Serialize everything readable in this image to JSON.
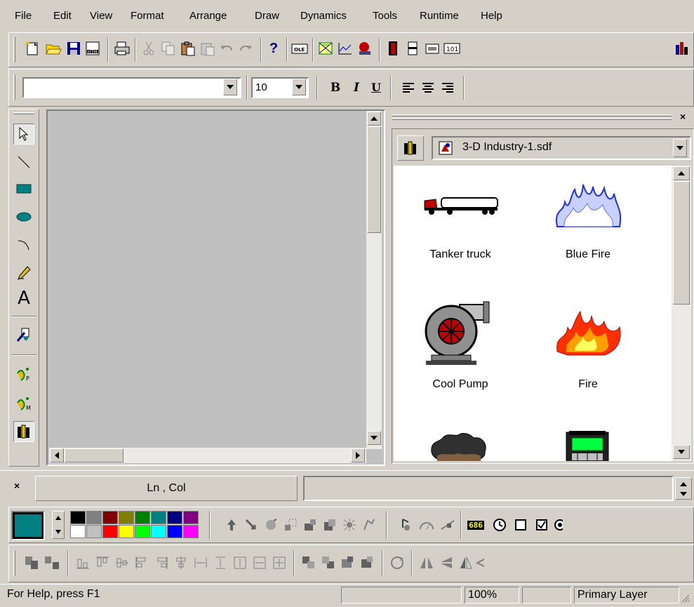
{
  "menu": [
    "File",
    "Edit",
    "View",
    "Format",
    "Arrange",
    "Draw",
    "Dynamics",
    "Tools",
    "Runtime",
    "Help"
  ],
  "format_toolbar": {
    "font_name": "",
    "font_size": "10",
    "bold_label": "B",
    "italic_label": "I",
    "underline_label": "U"
  },
  "library": {
    "file_name": "3-D Industry-1.sdf",
    "items": [
      {
        "label": "Tanker truck",
        "icon": "tanker-truck-icon"
      },
      {
        "label": "Blue Fire",
        "icon": "blue-fire-icon"
      },
      {
        "label": "Cool Pump",
        "icon": "cool-pump-icon"
      },
      {
        "label": "Fire",
        "icon": "fire-icon"
      },
      {
        "label": "",
        "icon": "smoke-icon"
      },
      {
        "label": "",
        "icon": "control-panel-icon"
      }
    ],
    "close_glyph": "×"
  },
  "output": {
    "ln_col": "Ln , Col",
    "close_glyph": "×"
  },
  "dynamics_toolbar": {
    "value_label": "686"
  },
  "palette": {
    "current_color": "#008080",
    "colors_row1": [
      "#000000",
      "#808080",
      "#800000",
      "#808000",
      "#008000",
      "#008080",
      "#000080",
      "#800080"
    ],
    "colors_row2": [
      "#ffffff",
      "#c0c0c0",
      "#ff0000",
      "#ffff00",
      "#00ff00",
      "#00ffff",
      "#0000ff",
      "#ff00ff"
    ]
  },
  "status": {
    "help_text": "For Help, press F1",
    "zoom": "100%",
    "layer": "Primary Layer"
  },
  "colors": {
    "face": "#d4d0c8",
    "canvas": "#c0c0c0",
    "accent_teal": "#008080"
  }
}
